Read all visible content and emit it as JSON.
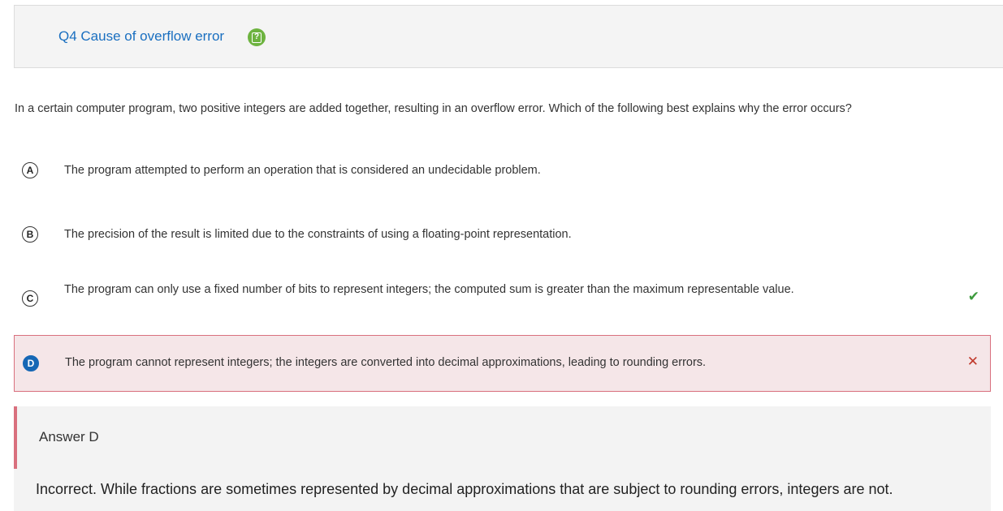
{
  "header": {
    "title": "Q4 Cause of overflow error",
    "help_icon_glyph": "?"
  },
  "question": {
    "text": "In a certain computer program, two positive integers are added together, resulting in an overflow error. Which of the following best explains why the error occurs?"
  },
  "options": [
    {
      "letter": "A",
      "text": "The program attempted to perform an operation that is considered an undecidable problem.",
      "status": "none"
    },
    {
      "letter": "B",
      "text": "The precision of the result is limited due to the constraints of using a floating-point representation.",
      "status": "none"
    },
    {
      "letter": "C",
      "text": "The program can only use a fixed number of bits to represent integers; the computed sum is greater than the maximum representable value.",
      "status": "correct",
      "mark": "✔"
    },
    {
      "letter": "D",
      "text": "The program cannot represent integers; the integers are converted into decimal approximations, leading to rounding errors.",
      "status": "selected-wrong",
      "mark": "✕"
    }
  ],
  "explanation": {
    "title": "Answer D",
    "body": "Incorrect. While fractions are sometimes represented by decimal approximations that are subject to rounding errors, integers are not."
  },
  "colors": {
    "link_blue": "#1a6fc0",
    "help_green": "#6db33f",
    "correct_green": "#3d9a3d",
    "wrong_red": "#c0392b",
    "selected_bg": "#f5e6e8",
    "selected_border": "#d9707e",
    "selected_letter_bg": "#1667b5"
  },
  "icons": {
    "help": "help-icon",
    "correct": "check-icon",
    "wrong": "close-icon"
  }
}
